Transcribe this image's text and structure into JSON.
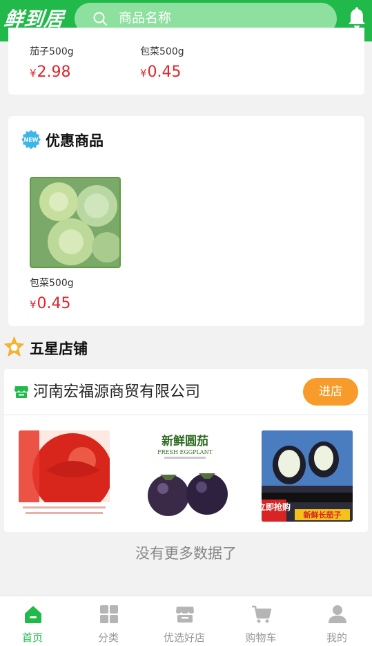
{
  "header": {
    "logo_text": "鲜到居",
    "search_placeholder": "商品名称",
    "brand_color": "#22b94b"
  },
  "top_products": [
    {
      "name": "茄子500g",
      "currency": "¥",
      "price": "2.98"
    },
    {
      "name": "包菜500g",
      "currency": "¥",
      "price": "0.45"
    }
  ],
  "promo": {
    "title": "优惠商品",
    "badge_text": "NEW",
    "items": [
      {
        "name": "包菜500g",
        "currency": "¥",
        "price": "0.45"
      }
    ]
  },
  "five_star": {
    "title": "五星店铺",
    "shop": {
      "name": "河南宏福源商贸有限公司",
      "enter_label": "进店",
      "products": [
        {
          "image": "tomato"
        },
        {
          "image": "round-eggplant",
          "headline": "新鲜圆茄",
          "subline": "FRESH EGGPLANT"
        },
        {
          "image": "long-eggplant",
          "tag1": "立即抢购",
          "tag2": "新鲜长茄子"
        }
      ]
    }
  },
  "footer_note": "没有更多数据了",
  "tabbar": {
    "items": [
      {
        "label": "首页",
        "icon": "home-icon",
        "active": true
      },
      {
        "label": "分类",
        "icon": "category-grid-icon",
        "active": false
      },
      {
        "label": "优选好店",
        "icon": "store-icon",
        "active": false
      },
      {
        "label": "购物车",
        "icon": "cart-icon",
        "active": false
      },
      {
        "label": "我的",
        "icon": "user-icon",
        "active": false
      }
    ],
    "active_color": "#22b94b",
    "inactive_color": "#999999"
  },
  "colors": {
    "price": "#e0242a",
    "enter_button": "#f79b2a"
  }
}
